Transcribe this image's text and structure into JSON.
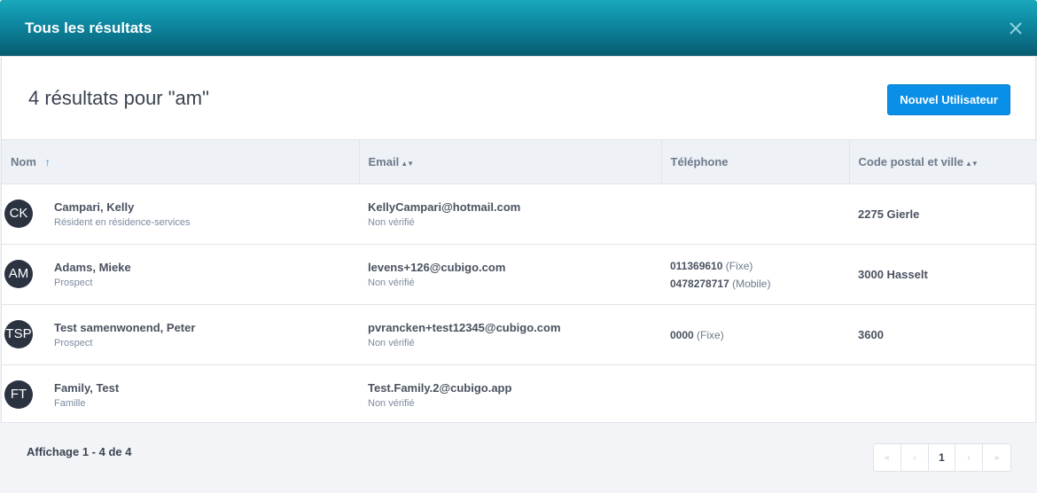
{
  "header": {
    "title": "Tous les résultats"
  },
  "main": {
    "results_title": "4 résultats pour \"am\"",
    "new_user_label": "Nouvel Utilisateur"
  },
  "table": {
    "columns": [
      "Nom",
      "Email",
      "Téléphone",
      "Code postal et ville"
    ],
    "rows": [
      {
        "initials": "CK",
        "name": "Campari, Kelly",
        "role": "Résident en résidence-services",
        "email": "KellyCampari@hotmail.com",
        "email_status": "Non vérifié",
        "phones": [],
        "postal": "2275 Gierle"
      },
      {
        "initials": "AM",
        "name": "Adams, Mieke",
        "role": "Prospect",
        "email": "levens+126@cubigo.com",
        "email_status": "Non vérifié",
        "phones": [
          {
            "number": "011369610",
            "type": "(Fixe)"
          },
          {
            "number": "0478278717",
            "type": "(Mobile)"
          }
        ],
        "postal": "3000 Hasselt"
      },
      {
        "initials": "TSP",
        "name": "Test samenwonend, Peter",
        "role": "Prospect",
        "email": "pvrancken+test12345@cubigo.com",
        "email_status": "Non vérifié",
        "phones": [
          {
            "number": "0000",
            "type": "(Fixe)"
          }
        ],
        "postal": "3600"
      },
      {
        "initials": "FT",
        "name": "Family, Test",
        "role": "Famille",
        "email": "Test.Family.2@cubigo.app",
        "email_status": "Non vérifié",
        "phones": [],
        "postal": ""
      }
    ]
  },
  "footer": {
    "info": "Affichage 1 - 4 de 4",
    "current_page": "1"
  },
  "colors": {
    "header": "#0a7a92",
    "accent": "#0a8fe8",
    "avatar": "#2b3240"
  },
  "icons": {
    "close": "close-icon",
    "first": "first-page-icon",
    "prev": "prev-page-icon",
    "next": "next-page-icon",
    "last": "last-page-icon"
  }
}
